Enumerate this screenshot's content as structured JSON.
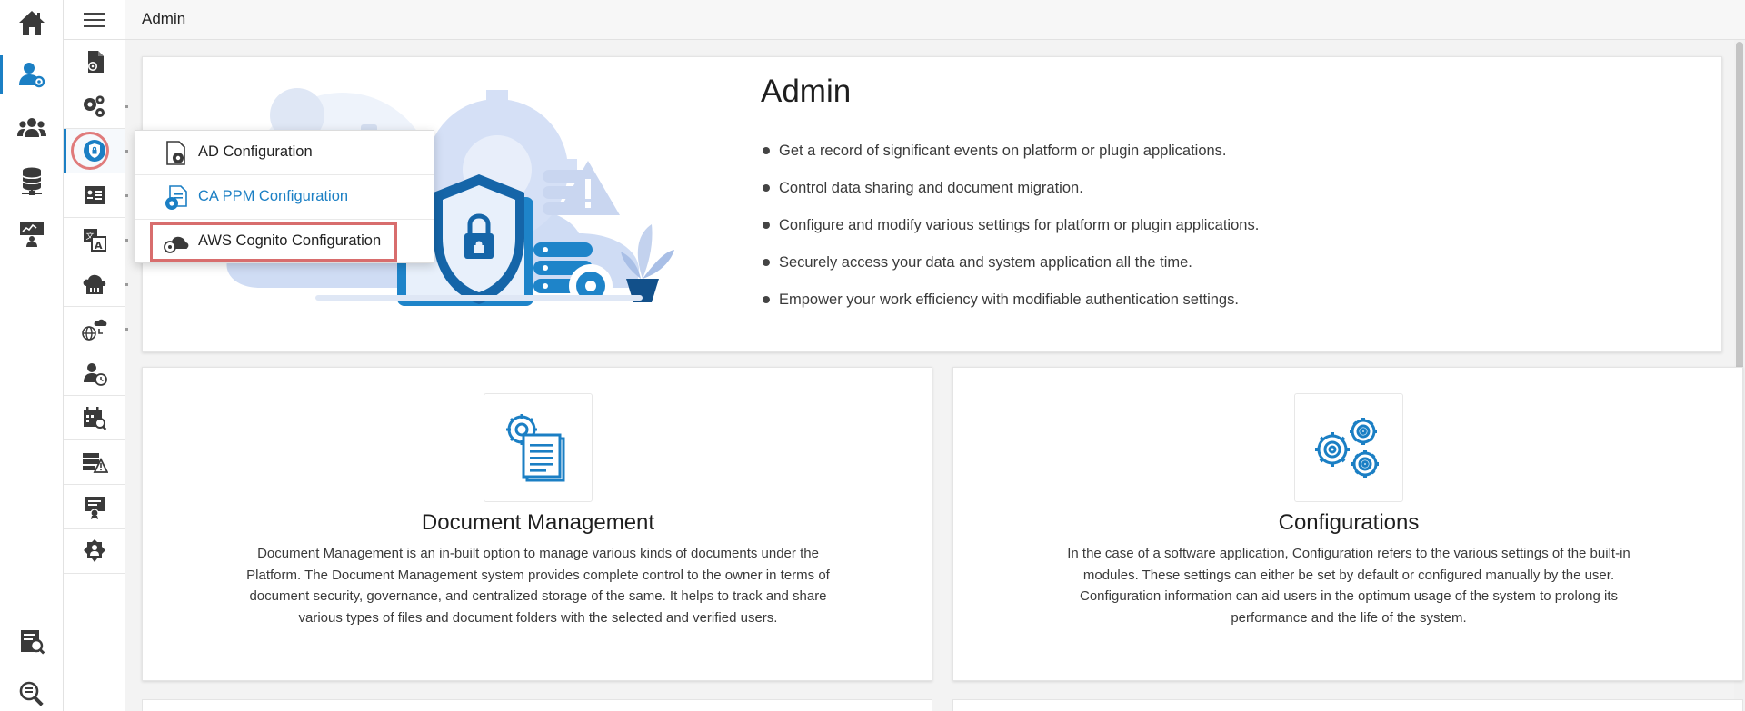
{
  "breadcrumb": "Admin",
  "colors": {
    "accent": "#1b7fc4",
    "highlight": "#d86d6d",
    "icon_gray": "#3a3a3a"
  },
  "rail": {
    "items": [
      {
        "icon": "home-icon",
        "label": "Home"
      },
      {
        "icon": "user-settings-icon",
        "label": "Admin",
        "active": true
      },
      {
        "icon": "users-group-icon",
        "label": "Users"
      },
      {
        "icon": "database-network-icon",
        "label": "Data"
      },
      {
        "icon": "presentation-icon",
        "label": "Presentation"
      }
    ],
    "bottom": [
      {
        "icon": "report-search-icon"
      },
      {
        "icon": "magnifier-icon"
      }
    ]
  },
  "submenu": {
    "items": [
      {
        "icon": "document-settings-icon"
      },
      {
        "icon": "gears-icon"
      },
      {
        "icon": "security-shield-icon",
        "active": true
      },
      {
        "icon": "id-card-icon"
      },
      {
        "icon": "translate-icon"
      },
      {
        "icon": "cloud-server-icon"
      },
      {
        "icon": "globe-cloud-icon"
      },
      {
        "icon": "user-clock-icon"
      },
      {
        "icon": "calendar-search-icon"
      },
      {
        "icon": "server-warning-icon"
      },
      {
        "icon": "certificate-icon"
      },
      {
        "icon": "user-badge-icon"
      }
    ]
  },
  "popup": {
    "items": [
      {
        "label": "AD Configuration",
        "icon": "document-gear-icon"
      },
      {
        "label": "CA PPM Configuration",
        "icon": "file-gear-icon"
      },
      {
        "label": "AWS Cognito Configuration",
        "icon": "cloud-gear-icon"
      }
    ]
  },
  "hero": {
    "title": "Admin",
    "bullets": [
      "Get a record of significant events on platform or plugin applications.",
      "Control data sharing and document migration.",
      "Configure and modify various settings for platform or plugin applications.",
      "Securely access your data and system application all the time.",
      "Empower your work efficiency with modifiable authentication settings."
    ]
  },
  "cards": [
    {
      "title": "Document Management",
      "icon": "document-settings-icon",
      "description": "Document Management is an in-built option to manage various kinds of documents under the Platform. The Document Management system provides complete control to the owner in terms of document security, governance, and centralized storage of the same. It helps to track and share various types of files and document folders with the selected and verified users."
    },
    {
      "title": "Configurations",
      "icon": "gears-icon",
      "description": "In the case of a software application, Configuration refers to the various settings of the built-in modules. These settings can either be set by default or configured manually by the user. Configuration information can aid users in the optimum usage of the system to prolong its performance and the life of the system."
    }
  ]
}
